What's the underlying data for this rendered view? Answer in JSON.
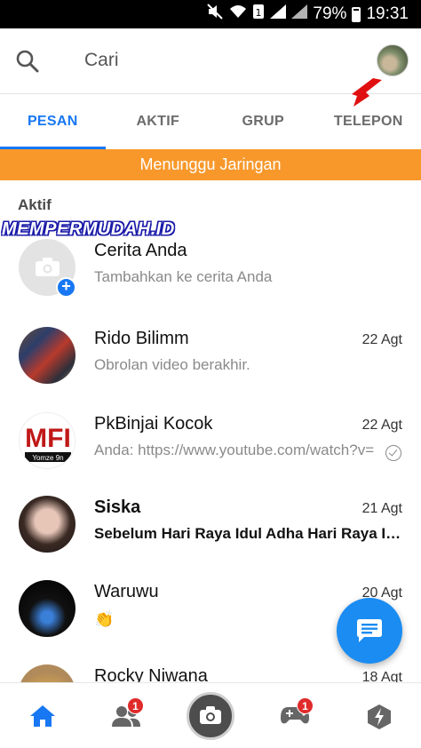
{
  "status_bar": {
    "battery": "79%",
    "time": "19:31"
  },
  "search": {
    "placeholder": "Cari"
  },
  "tabs": [
    {
      "label": "PESAN",
      "active": true
    },
    {
      "label": "AKTIF",
      "active": false
    },
    {
      "label": "GRUP",
      "active": false
    },
    {
      "label": "TELEPON",
      "active": false
    }
  ],
  "banner": {
    "text": "Menunggu Jaringan"
  },
  "section": {
    "label": "Aktif"
  },
  "watermark": {
    "text": "MEMPERMUDAH.ID"
  },
  "story": {
    "name": "Cerita Anda",
    "subtitle": "Tambahkan ke cerita Anda"
  },
  "conversations": [
    {
      "name": "Rido Bilimm",
      "message": "Obrolan video berakhir.",
      "time": "22 Agt",
      "unread": false
    },
    {
      "name": "PkBinjai Kocok",
      "message": "Anda: https://www.youtube.com/watch?v=",
      "time": "22 Agt",
      "unread": false,
      "avatar_text": "Yomze 9n"
    },
    {
      "name": "Siska",
      "message": "Sebelum Hari Raya Idul Adha Hari Raya Idul Fitri",
      "time": "21 Agt",
      "unread": true
    },
    {
      "name": "Waruwu",
      "message": "👏",
      "time": "20 Agt",
      "unread": false
    },
    {
      "name": "Rocky Niwana",
      "message": "",
      "time": "18 Agt",
      "unread": false
    }
  ],
  "bottom_nav": {
    "people_badge": "1",
    "games_badge": "1"
  },
  "colors": {
    "accent": "#1877f2",
    "banner": "#f8982b",
    "badge": "#e02b2b",
    "fab": "#1a8cf2"
  }
}
